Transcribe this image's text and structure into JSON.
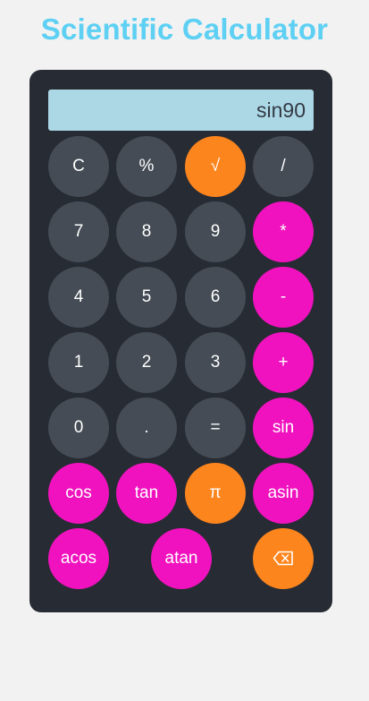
{
  "title": "Scientific Calculator",
  "display": {
    "value": "sin90"
  },
  "colors": {
    "title": "#5dd0f3",
    "panel": "#272b33",
    "display": "#acd8e6",
    "number_key": "#454c55",
    "function_key": "#f012be",
    "accent_key": "#fd851e"
  },
  "keys": {
    "clear": "C",
    "percent": "%",
    "sqrt": "√",
    "divide": "/",
    "seven": "7",
    "eight": "8",
    "nine": "9",
    "multiply": "*",
    "four": "4",
    "five": "5",
    "six": "6",
    "minus": "-",
    "one": "1",
    "two": "2",
    "three": "3",
    "plus": "+",
    "zero": "0",
    "dot": ".",
    "equals": "=",
    "sin": "sin",
    "cos": "cos",
    "tan": "tan",
    "pi": "π",
    "asin": "asin",
    "acos": "acos",
    "atan": "atan",
    "backspace_icon": "backspace-icon"
  }
}
